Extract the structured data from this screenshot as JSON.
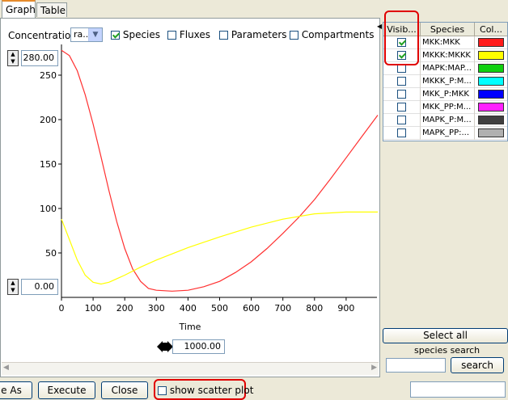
{
  "tabs": [
    {
      "label": "Graph"
    },
    {
      "label": "Table"
    }
  ],
  "toolbar": {
    "y_label": "Concentration",
    "y_select": "ra...",
    "checks": [
      {
        "label": "Species",
        "checked": true
      },
      {
        "label": "Fluxes",
        "checked": false
      },
      {
        "label": "Parameters",
        "checked": false
      },
      {
        "label": "Compartments",
        "checked": false
      }
    ]
  },
  "y_max_input": "280.00",
  "y_min_input": "0.00",
  "x_max_input": "1000.00",
  "chart_data": {
    "type": "line",
    "xlabel": "Time",
    "ylabel": "",
    "xlim": [
      0,
      1000
    ],
    "ylim": [
      0,
      280
    ],
    "x_ticks": [
      "0",
      "100",
      "200",
      "300",
      "400",
      "500",
      "600",
      "700",
      "800",
      "900"
    ],
    "y_ticks": [
      "50",
      "100",
      "150",
      "200",
      "250"
    ],
    "series": [
      {
        "name": "MKK:MKK",
        "color": "#ff3030",
        "x": [
          0,
          25,
          50,
          75,
          100,
          125,
          150,
          175,
          200,
          225,
          250,
          275,
          300,
          350,
          400,
          450,
          500,
          550,
          600,
          650,
          700,
          750,
          800,
          850,
          900,
          950,
          1000
        ],
        "y": [
          278,
          272,
          255,
          228,
          195,
          158,
          120,
          85,
          55,
          32,
          18,
          10,
          8,
          7,
          8,
          12,
          18,
          28,
          40,
          55,
          72,
          90,
          110,
          133,
          157,
          181,
          205
        ]
      },
      {
        "name": "MKKK:MKKK",
        "color": "#ffff00",
        "x": [
          0,
          25,
          50,
          75,
          100,
          125,
          150,
          175,
          200,
          250,
          300,
          400,
          500,
          600,
          700,
          800,
          900,
          1000
        ],
        "y": [
          88,
          65,
          42,
          25,
          17,
          15,
          17,
          21,
          25,
          34,
          42,
          56,
          68,
          79,
          88,
          94,
          96,
          96
        ]
      }
    ]
  },
  "species_table": {
    "headers": [
      "Visib...",
      "Species",
      "Col..."
    ],
    "rows": [
      {
        "visible": true,
        "name": "MKK:MKK",
        "color": "#ff1a1a"
      },
      {
        "visible": true,
        "name": "MKKK:MKKK",
        "color": "#ffff00"
      },
      {
        "visible": false,
        "name": "MAPK:MAP...",
        "color": "#10d010"
      },
      {
        "visible": false,
        "name": "MKKK_P:M...",
        "color": "#00ffff"
      },
      {
        "visible": false,
        "name": "MKK_P:MKK",
        "color": "#0000ff"
      },
      {
        "visible": false,
        "name": "MKK_PP:M...",
        "color": "#ff20ff"
      },
      {
        "visible": false,
        "name": "MAPK_P:M...",
        "color": "#404040"
      },
      {
        "visible": false,
        "name": "MAPK_PP:...",
        "color": "#b0b0b0"
      }
    ]
  },
  "select_all": "Select all",
  "species_search_label": "species search",
  "species_search_value": "",
  "search_button": "search",
  "bottom": {
    "save_as": "e As",
    "execute": "Execute",
    "close": "Close",
    "scatter_label": "show scatter plot",
    "scatter_checked": false,
    "status": ""
  }
}
